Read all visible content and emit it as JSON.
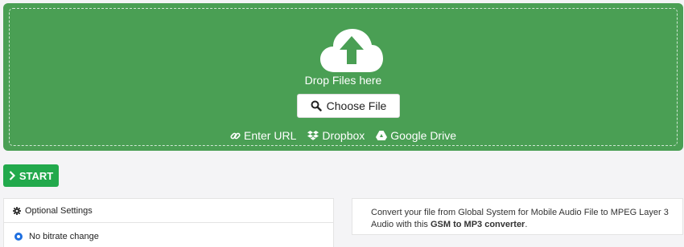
{
  "upload": {
    "drop_label": "Drop Files here",
    "choose_file_label": "Choose File",
    "sources": {
      "url_label": "Enter URL",
      "dropbox_label": "Dropbox",
      "google_drive_label": "Google Drive"
    },
    "icons": [
      "upload-cloud-icon",
      "search-icon",
      "link-icon",
      "dropbox-icon",
      "google-drive-icon"
    ],
    "accent_color": "#4a9f54"
  },
  "start_button": {
    "label": "START",
    "icon": "chevron-right-icon",
    "color": "#22a94c"
  },
  "optional_settings": {
    "title": "Optional Settings",
    "icon": "gear-icon",
    "options": [
      {
        "label": "No bitrate change",
        "selected": true
      }
    ]
  },
  "info": {
    "text_before": "Convert your file from Global System for Mobile Audio File to MPEG Layer 3 Audio with this ",
    "text_bold": "GSM to MP3 converter",
    "text_after": "."
  }
}
